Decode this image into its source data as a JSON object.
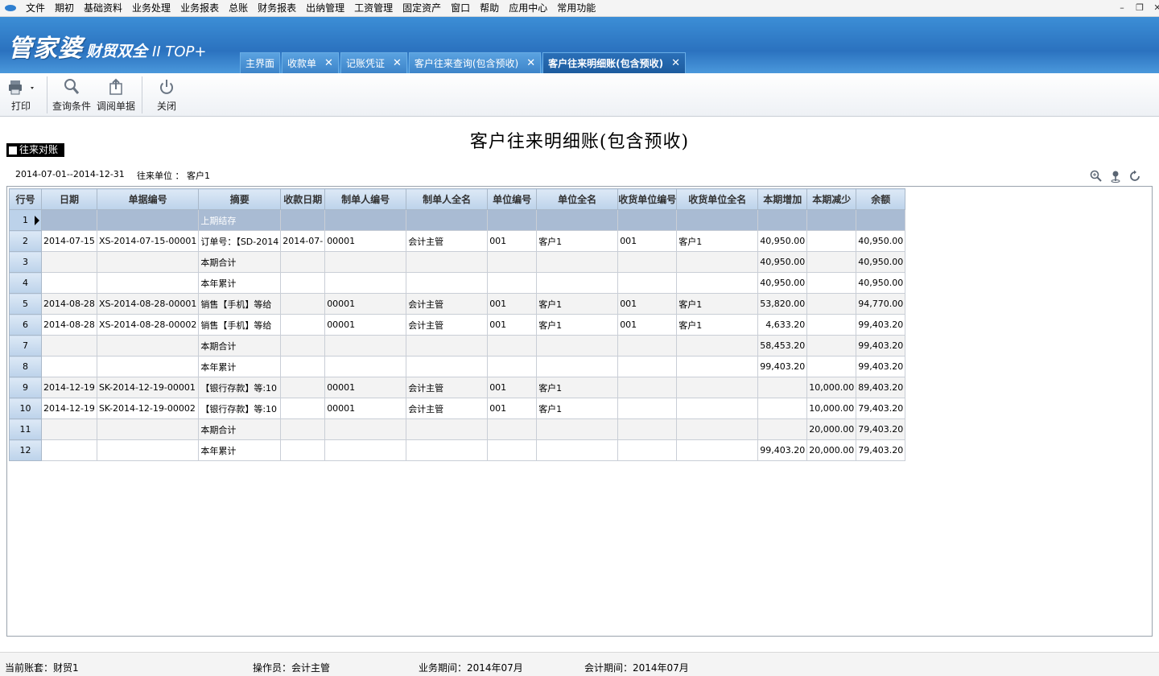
{
  "menu": [
    "文件",
    "期初",
    "基础资料",
    "业务处理",
    "业务报表",
    "总账",
    "财务报表",
    "出纳管理",
    "工资管理",
    "固定资产",
    "窗口",
    "帮助",
    "应用中心",
    "常用功能"
  ],
  "brand": {
    "main": "管家婆",
    "sub": "财贸双全",
    "version": "II TOP+"
  },
  "tabs": [
    {
      "label": "主界面",
      "closable": false
    },
    {
      "label": "收款单",
      "closable": true
    },
    {
      "label": "记账凭证",
      "closable": true
    },
    {
      "label": "客户往来查询(包含预收)",
      "closable": true
    },
    {
      "label": "客户往来明细账(包含预收)",
      "closable": true,
      "active": true
    }
  ],
  "toolbar": {
    "print": "打印",
    "query": "查询条件",
    "review": "调阅单据",
    "close": "关闭"
  },
  "report": {
    "title": "客户往来明细账(包含预收)",
    "reconcile_label": "往来对账",
    "period": "2014-07-01--2014-12-31",
    "unit_label": "往来单位 ： 客户1"
  },
  "grid": {
    "columns": [
      "行号",
      "日期",
      "单据编号",
      "摘要",
      "收款日期",
      "制单人编号",
      "制单人全名",
      "单位编号",
      "单位全名",
      "收货单位编号",
      "收货单位全名",
      "本期增加",
      "本期减少",
      "余额"
    ],
    "rows": [
      [
        "1",
        "",
        "",
        "上期结存",
        "",
        "",
        "",
        "",
        "",
        "",
        "",
        "",
        "",
        ""
      ],
      [
        "2",
        "2014-07-15",
        "XS-2014-07-15-00001",
        "订单号：【SD-2014",
        "2014-07-",
        "00001",
        "会计主管",
        "001",
        "客户1",
        "001",
        "客户1",
        "40,950.00",
        "",
        "40,950.00"
      ],
      [
        "3",
        "",
        "",
        "本期合计",
        "",
        "",
        "",
        "",
        "",
        "",
        "",
        "40,950.00",
        "",
        "40,950.00"
      ],
      [
        "4",
        "",
        "",
        "本年累计",
        "",
        "",
        "",
        "",
        "",
        "",
        "",
        "40,950.00",
        "",
        "40,950.00"
      ],
      [
        "5",
        "2014-08-28",
        "XS-2014-08-28-00001",
        "销售【手机】等给",
        "",
        "00001",
        "会计主管",
        "001",
        "客户1",
        "001",
        "客户1",
        "53,820.00",
        "",
        "94,770.00"
      ],
      [
        "6",
        "2014-08-28",
        "XS-2014-08-28-00002",
        "销售【手机】等给",
        "",
        "00001",
        "会计主管",
        "001",
        "客户1",
        "001",
        "客户1",
        "4,633.20",
        "",
        "99,403.20"
      ],
      [
        "7",
        "",
        "",
        "本期合计",
        "",
        "",
        "",
        "",
        "",
        "",
        "",
        "58,453.20",
        "",
        "99,403.20"
      ],
      [
        "8",
        "",
        "",
        "本年累计",
        "",
        "",
        "",
        "",
        "",
        "",
        "",
        "99,403.20",
        "",
        "99,403.20"
      ],
      [
        "9",
        "2014-12-19",
        "SK-2014-12-19-00001",
        "【银行存款】等:10",
        "",
        "00001",
        "会计主管",
        "001",
        "客户1",
        "",
        "",
        "",
        "10,000.00",
        "89,403.20"
      ],
      [
        "10",
        "2014-12-19",
        "SK-2014-12-19-00002",
        "【银行存款】等:10",
        "",
        "00001",
        "会计主管",
        "001",
        "客户1",
        "",
        "",
        "",
        "10,000.00",
        "79,403.20"
      ],
      [
        "11",
        "",
        "",
        "本期合计",
        "",
        "",
        "",
        "",
        "",
        "",
        "",
        "",
        "20,000.00",
        "79,403.20"
      ],
      [
        "12",
        "",
        "",
        "本年累计",
        "",
        "",
        "",
        "",
        "",
        "",
        "",
        "99,403.20",
        "20,000.00",
        "79,403.20"
      ]
    ]
  },
  "status": {
    "account": "当前账套：财贸1",
    "operator": "操作员：会计主管",
    "biz_period": "业务期间：2014年07月",
    "acc_period": "会计期间：2014年07月"
  },
  "colors": {
    "header_blue": "#2b72bf",
    "grid_header": "#bcd2ea",
    "selected_row": "#a9bbd3"
  }
}
